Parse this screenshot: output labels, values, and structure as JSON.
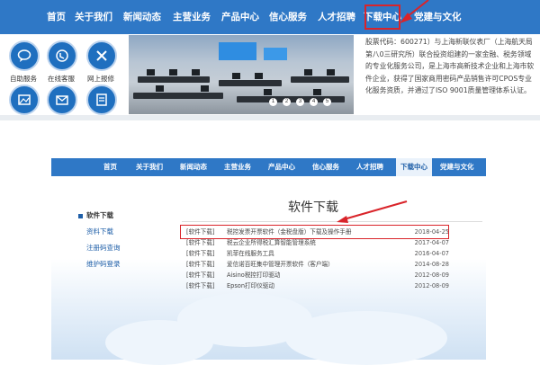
{
  "top": {
    "nav": [
      "首页",
      "关于我们",
      "新闻动态",
      "主营业务",
      "产品中心",
      "信心服务",
      "人才招聘",
      "下载中心",
      "党建与文化"
    ],
    "active_nav": "下载中心",
    "icons": [
      {
        "label": "自助服务",
        "icon": "chat-bubble-icon"
      },
      {
        "label": "在线客服",
        "icon": "headset-icon"
      },
      {
        "label": "网上报修",
        "icon": "tools-icon"
      },
      {
        "label": "",
        "icon": "image-icon"
      },
      {
        "label": "",
        "icon": "mail-icon"
      },
      {
        "label": "",
        "icon": "document-icon"
      }
    ],
    "banner_pages": [
      "1",
      "2",
      "3",
      "4",
      "5"
    ],
    "company_text": "股票代码：600271）与上海新联仪表厂（上海航天局第八0三研究所）联合投资组建的一家金融、税务领域的专业化服务公司，是上海市高新技术企业和上海市软件企业，获得了国家商用密码产品销售许可CPOS专业化服务资质，并通过了ISO 9001质量管理体系认证。"
  },
  "bottom": {
    "nav": [
      "首页",
      "关于我们",
      "新闻动态",
      "主营业务",
      "产品中心",
      "信心服务",
      "人才招聘",
      "下载中心",
      "党建与文化"
    ],
    "active_nav": "下载中心",
    "side_menu": {
      "header": "软件下载",
      "items": [
        "资料下载",
        "注册码查询",
        "维护码登录"
      ]
    },
    "title": "软件下载",
    "rows": [
      {
        "tag": "[软件下载]",
        "name": "税控发票开票软件（金税盘版）下载及操作手册",
        "date": "2018-04-25"
      },
      {
        "tag": "[软件下载]",
        "name": "税云企业所得税汇算智能管理系统",
        "date": "2017-04-07"
      },
      {
        "tag": "[软件下载]",
        "name": "凯菲在线服务工具",
        "date": "2016-04-07"
      },
      {
        "tag": "[软件下载]",
        "name": "爱信诺百旺集中管理开票软件（客户端）",
        "date": "2014-08-28"
      },
      {
        "tag": "[软件下载]",
        "name": "Aisino税控打印驱动",
        "date": "2012-08-09"
      },
      {
        "tag": "[软件下载]",
        "name": "Epson打印仪驱动",
        "date": "2012-08-09"
      }
    ]
  },
  "colors": {
    "nav_blue": "#2f78c6",
    "highlight_red": "#d9242a",
    "link_blue": "#1f5fa8"
  }
}
